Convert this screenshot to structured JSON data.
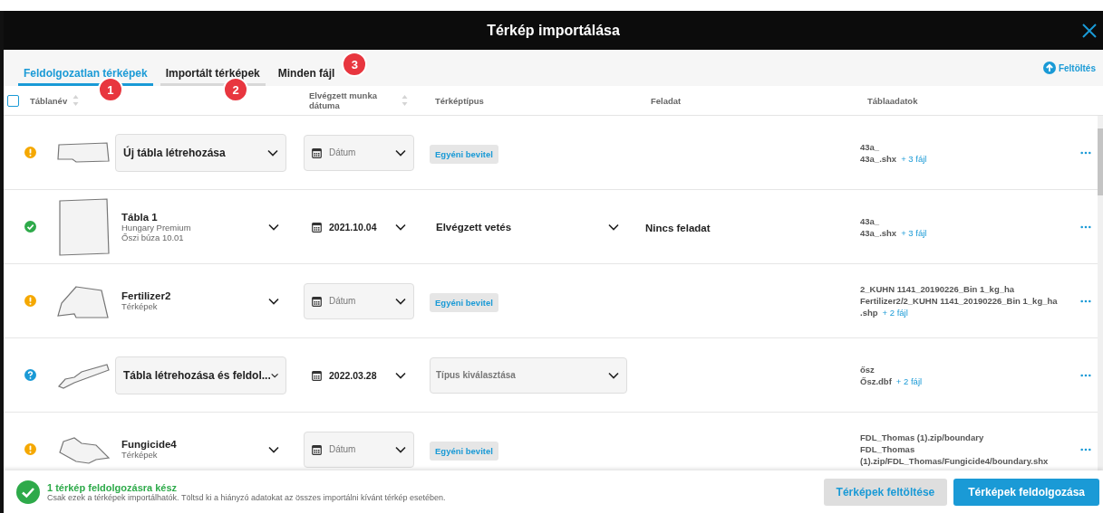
{
  "window": {
    "title": "Térkép importálása"
  },
  "tabs": [
    {
      "label": "Feldolgozatlan térképek",
      "selected": true,
      "badge": "1"
    },
    {
      "label": "Importált térképek",
      "selected": false,
      "badge": "2"
    },
    {
      "label": "Minden fájl",
      "selected": false,
      "badge": "3"
    }
  ],
  "upload_link": "Feltöltés",
  "select_all": {
    "checked": false
  },
  "columns": [
    {
      "label": "Táblanév",
      "sortable": true
    },
    {
      "label": "Elvégzett munka dátuma",
      "sortable": true
    },
    {
      "label": "Térképtípus",
      "sortable": false
    },
    {
      "label": "Feladat",
      "sortable": false
    },
    {
      "label": "Táblaadatok",
      "sortable": false
    }
  ],
  "rows": [
    {
      "status": {
        "kind": "warning"
      },
      "name": {
        "kind": "select",
        "value": "Új tábla létrehozása"
      },
      "date": {
        "kind": "box",
        "placeholder": "Dátum"
      },
      "type": {
        "kind": "tag",
        "value": "Egyéni bevitel"
      },
      "files": {
        "lines": [
          "43a_",
          "43a_.shx"
        ],
        "more": "+ 3 fájl"
      }
    },
    {
      "status": {
        "kind": "ok"
      },
      "name": {
        "kind": "field",
        "value": "Tábla 1",
        "details": [
          "Hungary Premium",
          "Őszi búza 10.01"
        ]
      },
      "date": {
        "kind": "value",
        "value": "2021.10.04"
      },
      "type": {
        "kind": "select_plain",
        "value": "Elvégzett vetés"
      },
      "task": "Nincs feladat",
      "files": {
        "lines": [
          "43a_",
          "43a_.shx"
        ],
        "more": "+ 3 fájl"
      }
    },
    {
      "status": {
        "kind": "warning"
      },
      "name": {
        "kind": "field",
        "value": "Fertilizer2",
        "details": [
          "Térképek"
        ]
      },
      "date": {
        "kind": "box",
        "placeholder": "Dátum"
      },
      "type": {
        "kind": "tag",
        "value": "Egyéni bevitel"
      },
      "files": {
        "lines": [
          "2_KUHN 1141_20190226_Bin 1_kg_ha",
          "Fertilizer2/2_KUHN 1141_20190226_Bin 1_kg_ha",
          ".shp"
        ],
        "more": "+ 2 fájl"
      }
    },
    {
      "status": {
        "kind": "info"
      },
      "name": {
        "kind": "select",
        "value": "Tábla létrehozása és feldol..."
      },
      "date": {
        "kind": "value",
        "value": "2022.03.28"
      },
      "type": {
        "kind": "select_box",
        "placeholder": "Típus kiválasztása"
      },
      "files": {
        "lines": [
          "ősz",
          "Ősz.dbf"
        ],
        "more": "+ 2 fájl"
      }
    },
    {
      "status": {
        "kind": "warning"
      },
      "name": {
        "kind": "field",
        "value": "Fungicide4",
        "details": [
          "Térképek"
        ]
      },
      "date": {
        "kind": "box",
        "placeholder": "Dátum"
      },
      "type": {
        "kind": "tag",
        "value": "Egyéni bevitel"
      },
      "files": {
        "lines": [
          "FDL_Thomas (1).zip/boundary",
          "FDL_Thomas",
          "(1).zip/FDL_Thomas/Fungicide4/boundary.shx"
        ]
      }
    }
  ],
  "footer": {
    "title": "1 térkép feldolgozásra kész",
    "message": "Csak ezek a térképek importálhatók. Töltsd ki a hiányzó adatokat az összes importálni kívánt térkép esetében.",
    "buttons": [
      {
        "label": "Térképek feltöltése",
        "kind": "secondary"
      },
      {
        "label": "Térképek feldolgozása",
        "kind": "primary"
      }
    ]
  }
}
